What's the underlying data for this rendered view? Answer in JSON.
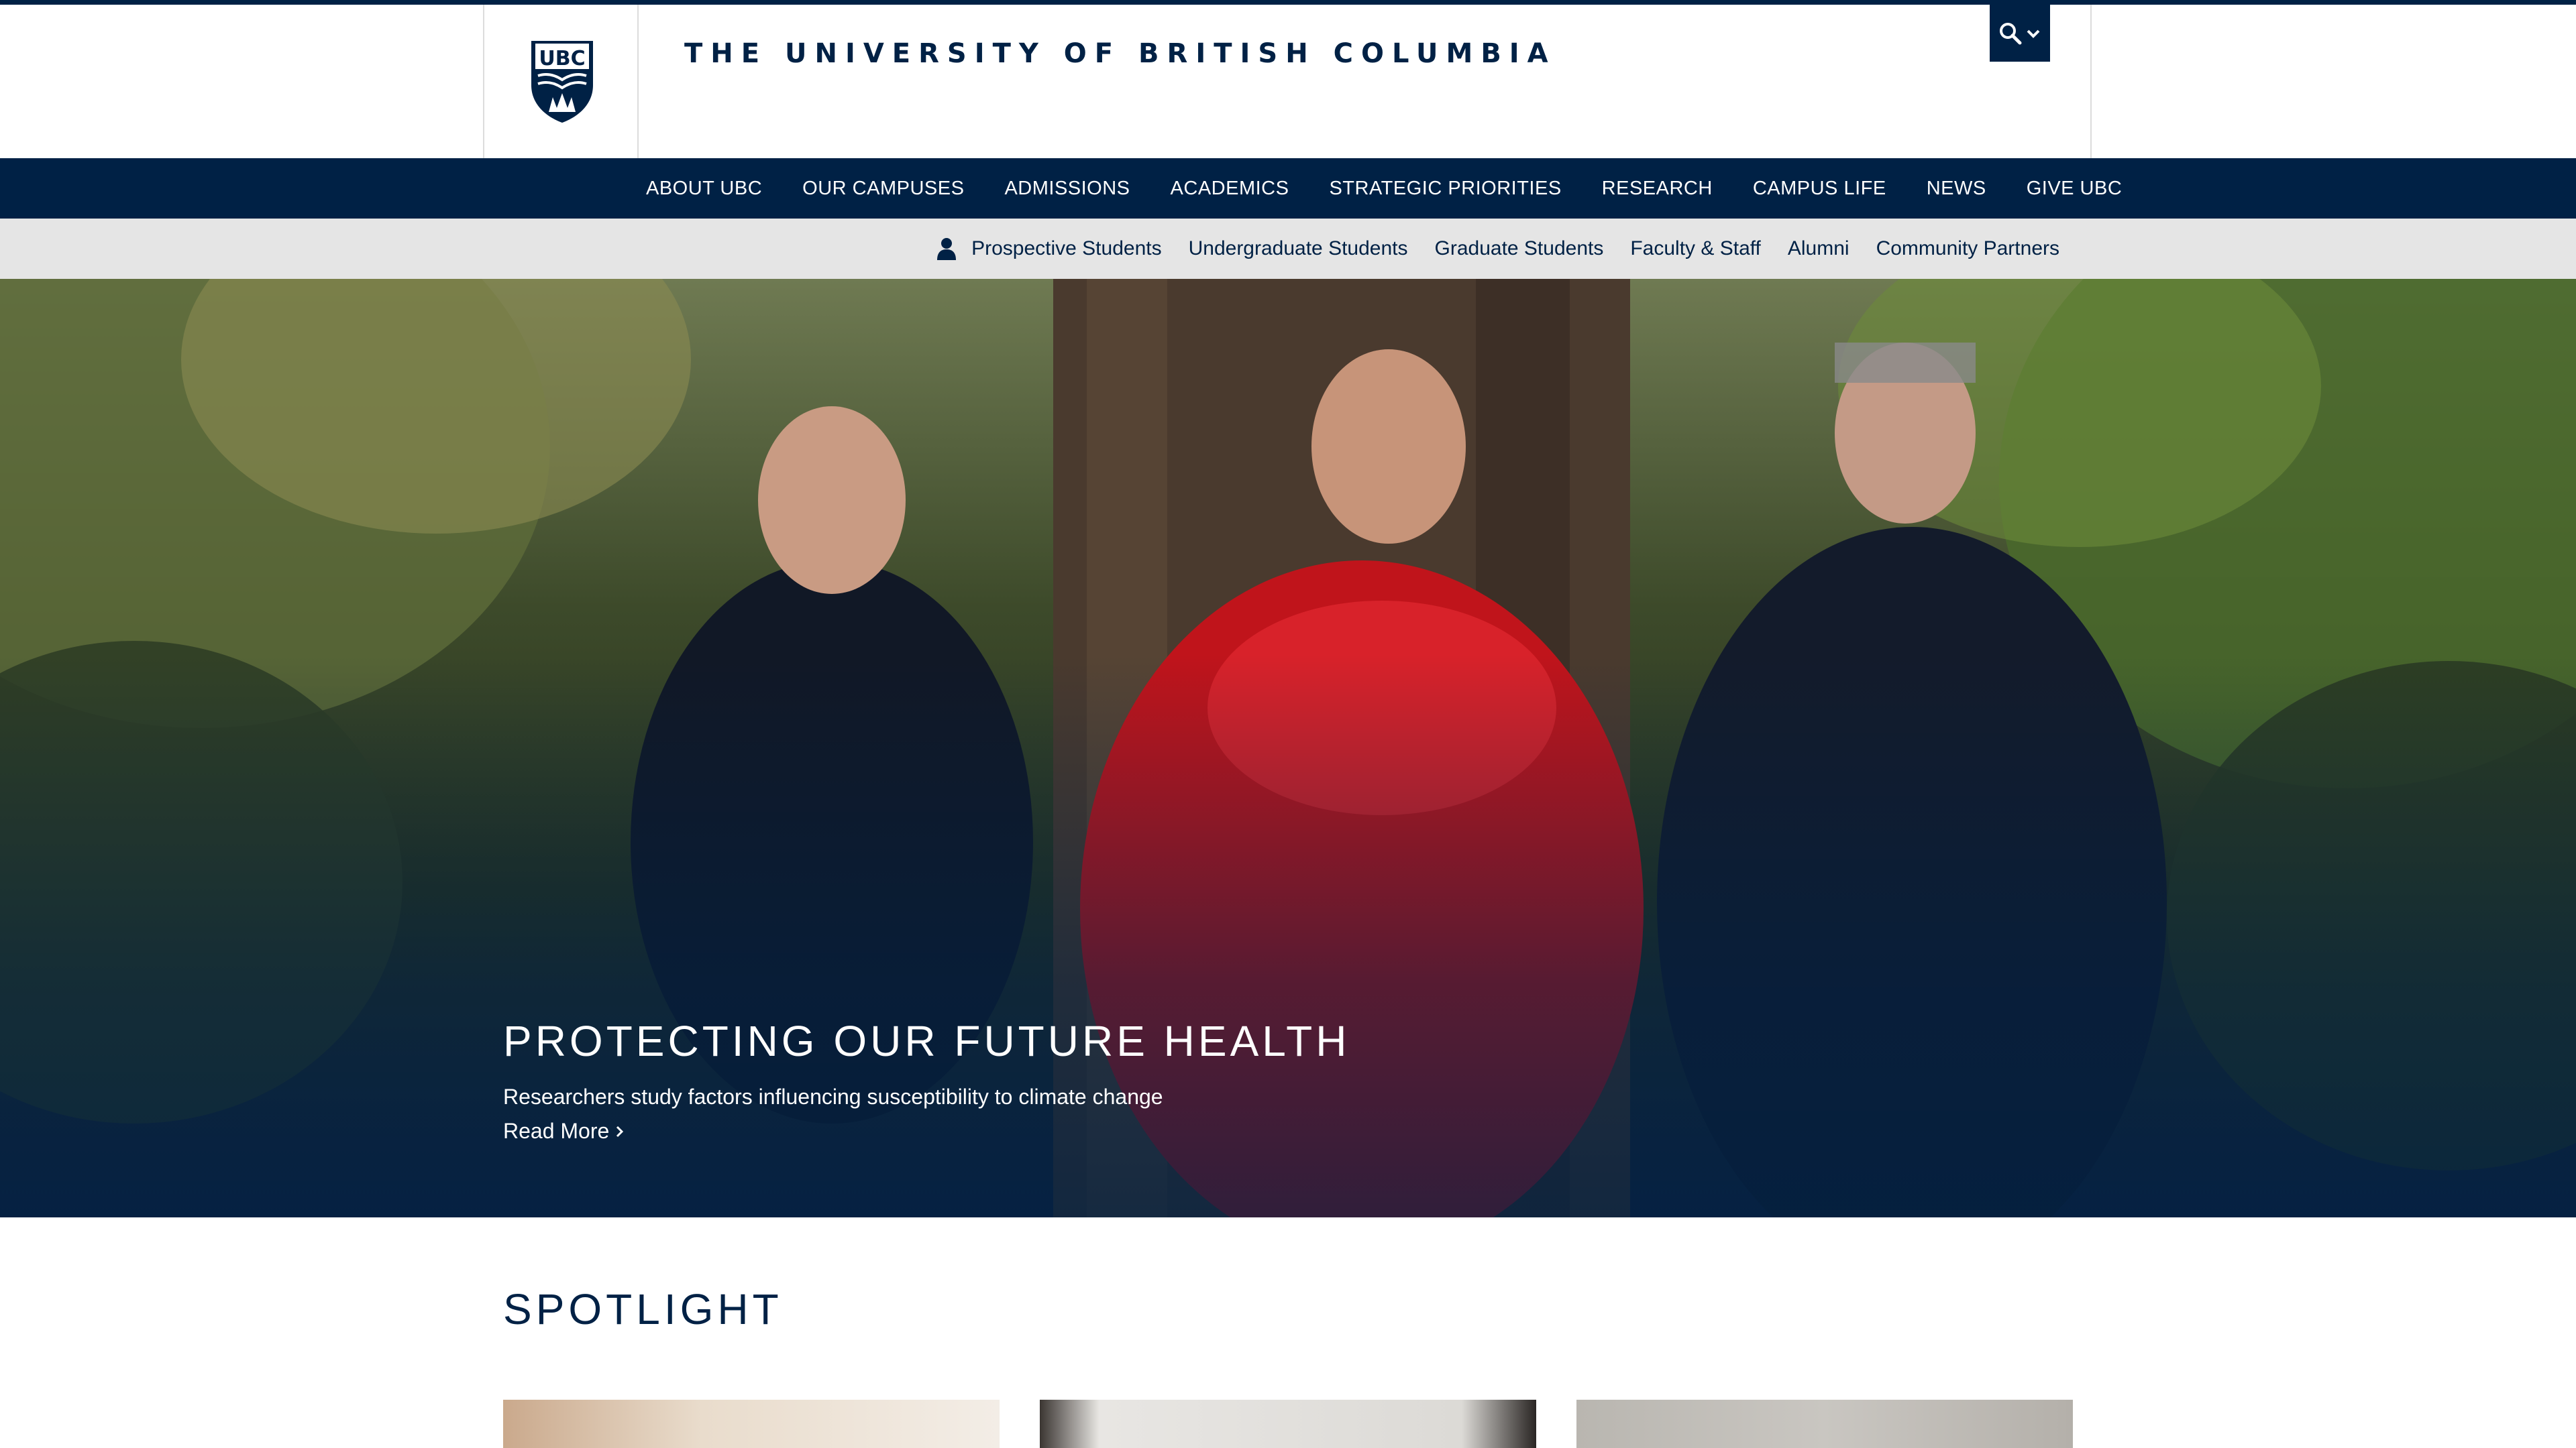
{
  "header": {
    "crest_text": "UBC",
    "wordmark": "THE UNIVERSITY OF BRITISH COLUMBIA",
    "search_icon": "search-icon",
    "dropdown_icon": "chevron-down-icon"
  },
  "main_nav": {
    "items": [
      {
        "label": "ABOUT UBC"
      },
      {
        "label": "OUR CAMPUSES"
      },
      {
        "label": "ADMISSIONS"
      },
      {
        "label": "ACADEMICS"
      },
      {
        "label": "STRATEGIC PRIORITIES"
      },
      {
        "label": "RESEARCH"
      },
      {
        "label": "CAMPUS LIFE"
      },
      {
        "label": "NEWS"
      },
      {
        "label": "GIVE UBC"
      }
    ]
  },
  "audience_nav": {
    "icon": "user-icon",
    "items": [
      {
        "label": "Prospective Students"
      },
      {
        "label": "Undergraduate Students"
      },
      {
        "label": "Graduate Students"
      },
      {
        "label": "Faculty & Staff"
      },
      {
        "label": "Alumni"
      },
      {
        "label": "Community Partners"
      }
    ]
  },
  "hero": {
    "title": "PROTECTING OUR FUTURE HEALTH",
    "subtitle": "Researchers study factors influencing susceptibility to climate change",
    "link_label": "Read More",
    "link_icon": "chevron-right-icon"
  },
  "spotlight": {
    "title": "SPOTLIGHT"
  },
  "colors": {
    "brand_navy": "#002145",
    "audience_bar": "#e5e5e5",
    "white": "#ffffff"
  }
}
